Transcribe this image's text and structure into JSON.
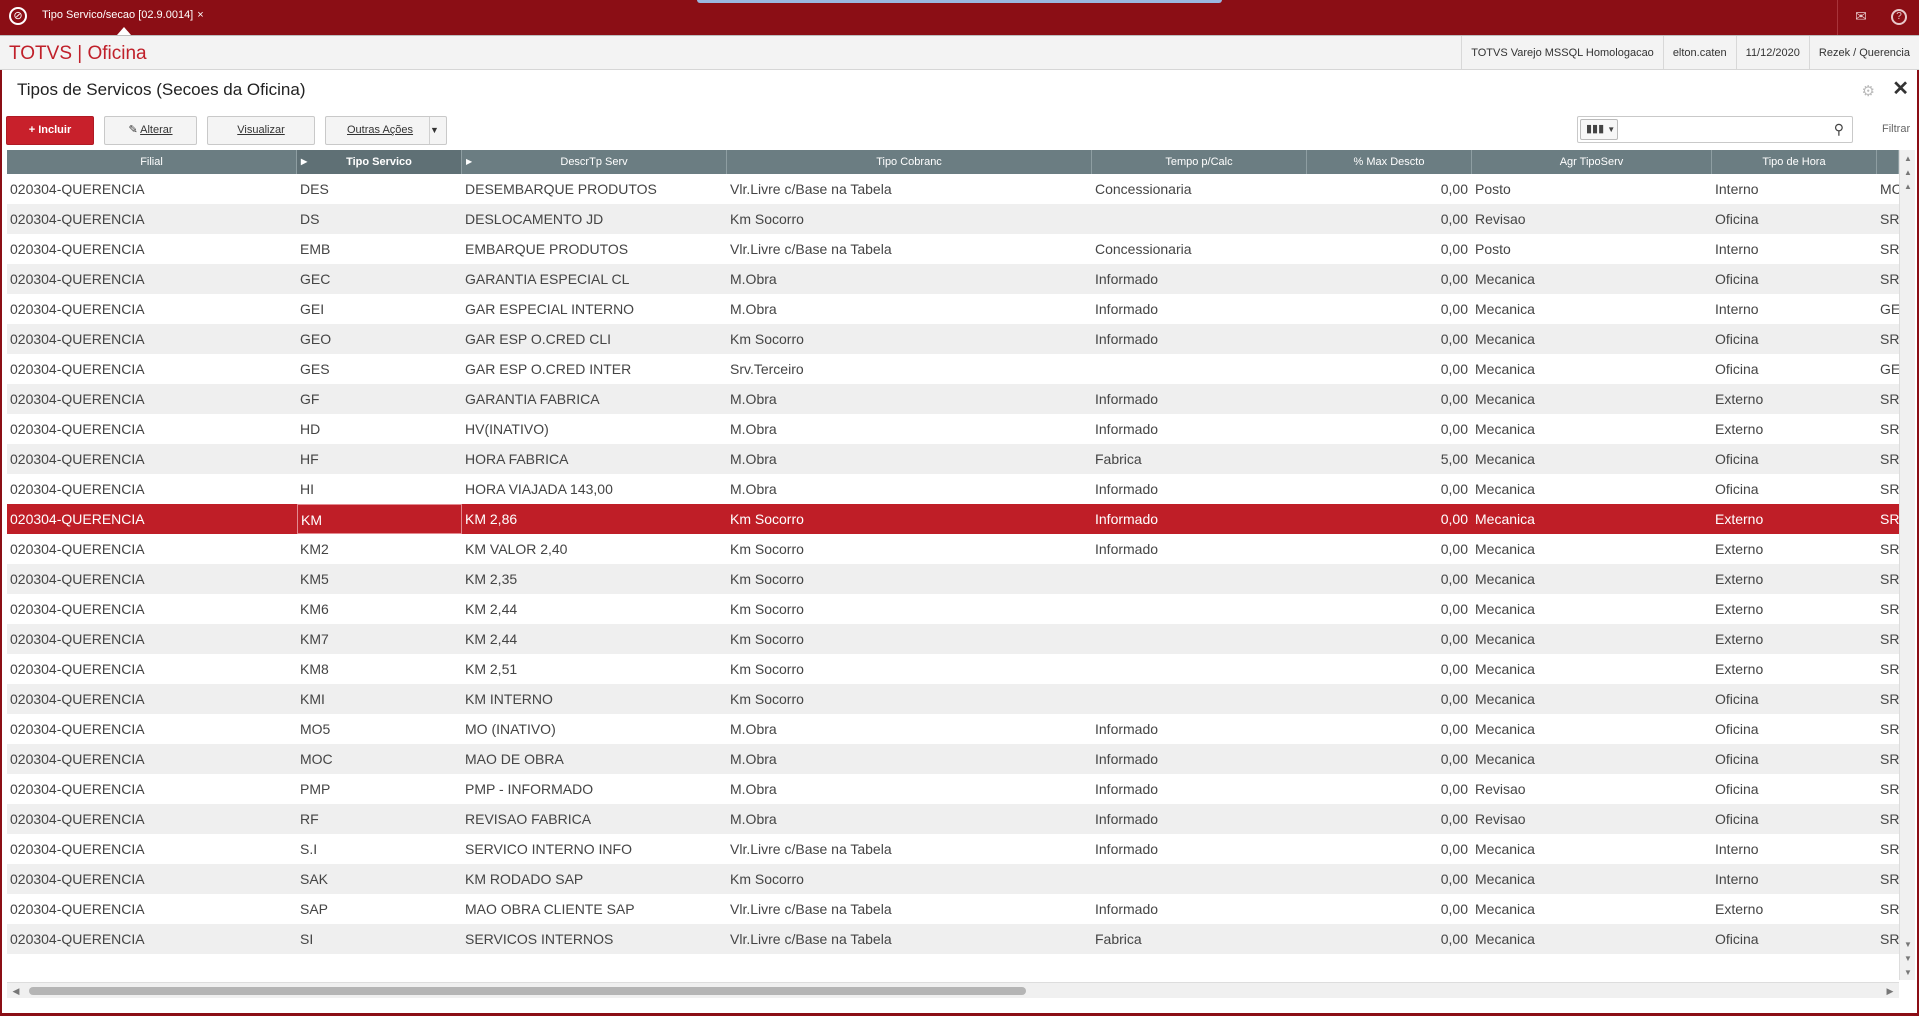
{
  "topbar": {
    "tab_label": "Tipo Servico/secao [02.9.0014]",
    "tab_close": "×",
    "mail_icon": "✉",
    "help_icon": "?"
  },
  "appbar": {
    "brand": "TOTVS | Oficina",
    "environment": "TOTVS Varejo MSSQL Homologacao",
    "user": "elton.caten",
    "date": "11/12/2020",
    "branch": "Rezek / Querencia"
  },
  "page": {
    "title": "Tipos de Servicos (Secoes da Oficina)"
  },
  "toolbar": {
    "include": "Incluir",
    "alter": "Alterar",
    "view": "Visualizar",
    "other_actions": "Outras Ações",
    "search_placeholder": "",
    "filter_label": "Filtrar"
  },
  "grid": {
    "headers": [
      "Filial",
      "Tipo Servico",
      "DescrTp Serv",
      "Tipo Cobranc",
      "Tempo p/Calc",
      "% Max Descto",
      "Agr TipoServ",
      "Tipo de Hora"
    ],
    "selected_index": 11,
    "rows": [
      [
        "020304-QUERENCIA",
        "DES",
        "DESEMBARQUE PRODUTOS",
        "Vlr.Livre c/Base na Tabela",
        "Concessionaria",
        "0,00",
        "Posto",
        "Interno",
        "MC"
      ],
      [
        "020304-QUERENCIA",
        "DS",
        "DESLOCAMENTO JD",
        "Km Socorro",
        "",
        "0,00",
        "Revisao",
        "Oficina",
        "SR"
      ],
      [
        "020304-QUERENCIA",
        "EMB",
        "EMBARQUE PRODUTOS",
        "Vlr.Livre c/Base na Tabela",
        "Concessionaria",
        "0,00",
        "Posto",
        "Interno",
        "SR"
      ],
      [
        "020304-QUERENCIA",
        "GEC",
        "GARANTIA ESPECIAL CL",
        "M.Obra",
        "Informado",
        "0,00",
        "Mecanica",
        "Oficina",
        "SR"
      ],
      [
        "020304-QUERENCIA",
        "GEI",
        "GAR ESPECIAL INTERNO",
        "M.Obra",
        "Informado",
        "0,00",
        "Mecanica",
        "Interno",
        "GE"
      ],
      [
        "020304-QUERENCIA",
        "GEO",
        "GAR ESP O.CRED CLI",
        "Km Socorro",
        "Informado",
        "0,00",
        "Mecanica",
        "Oficina",
        "SR"
      ],
      [
        "020304-QUERENCIA",
        "GES",
        "GAR ESP O.CRED INTER",
        "Srv.Terceiro",
        "",
        "0,00",
        "Mecanica",
        "Oficina",
        "GE"
      ],
      [
        "020304-QUERENCIA",
        "GF",
        "GARANTIA FABRICA",
        "M.Obra",
        "Informado",
        "0,00",
        "Mecanica",
        "Externo",
        "SR"
      ],
      [
        "020304-QUERENCIA",
        "HD",
        "HV(INATIVO)",
        "M.Obra",
        "Informado",
        "0,00",
        "Mecanica",
        "Externo",
        "SR"
      ],
      [
        "020304-QUERENCIA",
        "HF",
        "HORA FABRICA",
        "M.Obra",
        "Fabrica",
        "5,00",
        "Mecanica",
        "Oficina",
        "SR"
      ],
      [
        "020304-QUERENCIA",
        "HI",
        "HORA VIAJADA 143,00",
        "M.Obra",
        "Informado",
        "0,00",
        "Mecanica",
        "Oficina",
        "SR"
      ],
      [
        "020304-QUERENCIA",
        "KM",
        "KM 2,86",
        "Km Socorro",
        "Informado",
        "0,00",
        "Mecanica",
        "Externo",
        "SR"
      ],
      [
        "020304-QUERENCIA",
        "KM2",
        "KM VALOR 2,40",
        "Km Socorro",
        "Informado",
        "0,00",
        "Mecanica",
        "Externo",
        "SR"
      ],
      [
        "020304-QUERENCIA",
        "KM5",
        "KM 2,35",
        "Km Socorro",
        "",
        "0,00",
        "Mecanica",
        "Externo",
        "SR"
      ],
      [
        "020304-QUERENCIA",
        "KM6",
        "KM 2,44",
        "Km Socorro",
        "",
        "0,00",
        "Mecanica",
        "Externo",
        "SR"
      ],
      [
        "020304-QUERENCIA",
        "KM7",
        "KM 2,44",
        "Km Socorro",
        "",
        "0,00",
        "Mecanica",
        "Externo",
        "SR"
      ],
      [
        "020304-QUERENCIA",
        "KM8",
        "KM 2,51",
        "Km Socorro",
        "",
        "0,00",
        "Mecanica",
        "Externo",
        "SR"
      ],
      [
        "020304-QUERENCIA",
        "KMI",
        "KM INTERNO",
        "Km Socorro",
        "",
        "0,00",
        "Mecanica",
        "Oficina",
        "SR"
      ],
      [
        "020304-QUERENCIA",
        "MO5",
        "MO (INATIVO)",
        "M.Obra",
        "Informado",
        "0,00",
        "Mecanica",
        "Oficina",
        "SR"
      ],
      [
        "020304-QUERENCIA",
        "MOC",
        "MAO DE OBRA",
        "M.Obra",
        "Informado",
        "0,00",
        "Mecanica",
        "Oficina",
        "SR"
      ],
      [
        "020304-QUERENCIA",
        "PMP",
        "PMP - INFORMADO",
        "M.Obra",
        "Informado",
        "0,00",
        "Revisao",
        "Oficina",
        "SR"
      ],
      [
        "020304-QUERENCIA",
        "RF",
        "REVISAO FABRICA",
        "M.Obra",
        "Informado",
        "0,00",
        "Revisao",
        "Oficina",
        "SR"
      ],
      [
        "020304-QUERENCIA",
        "S.I",
        "SERVICO INTERNO INFO",
        "Vlr.Livre c/Base na Tabela",
        "Informado",
        "0,00",
        "Mecanica",
        "Interno",
        "SR"
      ],
      [
        "020304-QUERENCIA",
        "SAK",
        "KM RODADO SAP",
        "Km Socorro",
        "",
        "0,00",
        "Mecanica",
        "Interno",
        "SR"
      ],
      [
        "020304-QUERENCIA",
        "SAP",
        "MAO OBRA CLIENTE SAP",
        "Vlr.Livre c/Base na Tabela",
        "Informado",
        "0,00",
        "Mecanica",
        "Externo",
        "SR"
      ],
      [
        "020304-QUERENCIA",
        "SI",
        "SERVICOS INTERNOS",
        "Vlr.Livre c/Base na Tabela",
        "Fabrica",
        "0,00",
        "Mecanica",
        "Oficina",
        "SR"
      ]
    ]
  }
}
